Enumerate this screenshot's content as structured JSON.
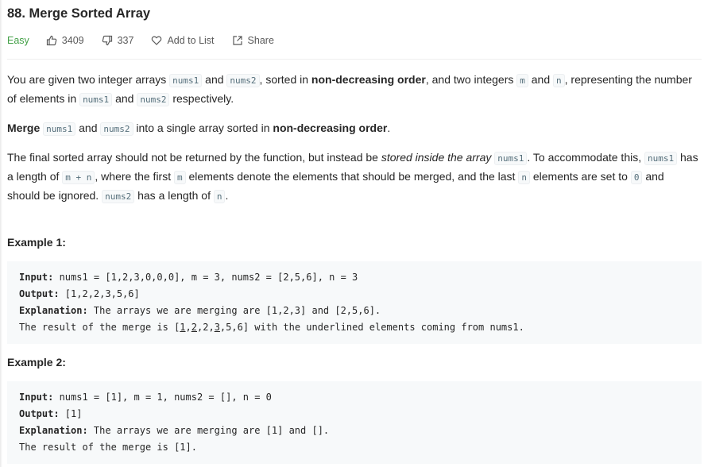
{
  "problem": {
    "title": "88. Merge Sorted Array",
    "difficulty": "Easy",
    "likes": "3409",
    "dislikes": "337",
    "add_to_list": "Add to List",
    "share": "Share"
  },
  "description": {
    "p1": {
      "t1": "You are given two integer arrays ",
      "c1": "nums1",
      "t2": " and ",
      "c2": "nums2",
      "t3": ", sorted in ",
      "b1": "non-decreasing order",
      "t4": ", and two integers ",
      "c3": "m",
      "t5": " and ",
      "c4": "n",
      "t6": ", representing the number of elements in ",
      "c5": "nums1",
      "t7": " and ",
      "c6": "nums2",
      "t8": " respectively."
    },
    "p2": {
      "b1": "Merge",
      "t1": " ",
      "c1": "nums1",
      "t2": " and ",
      "c2": "nums2",
      "t3": " into a single array sorted in ",
      "b2": "non-decreasing order",
      "t4": "."
    },
    "p3": {
      "t1": "The final sorted array should not be returned by the function, but instead be ",
      "i1": "stored inside the array",
      "t2": " ",
      "c1": "nums1",
      "t3": ". To accommodate this, ",
      "c2": "nums1",
      "t4": " has a length of ",
      "c3": "m + n",
      "t5": ", where the first ",
      "c4": "m",
      "t6": " elements denote the elements that should be merged, and the last ",
      "c5": "n",
      "t7": " elements are set to ",
      "c6": "0",
      "t8": " and should be ignored. ",
      "c7": "nums2",
      "t9": " has a length of ",
      "c8": "n",
      "t10": "."
    }
  },
  "examples": [
    {
      "title": "Example 1:",
      "input_label": "Input:",
      "input": " nums1 = [1,2,3,0,0,0], m = 3, nums2 = [2,5,6], n = 3",
      "output_label": "Output:",
      "output": " [1,2,2,3,5,6]",
      "explanation_label": "Explanation:",
      "explanation": " The arrays we are merging are [1,2,3] and [2,5,6].",
      "result_prefix": "The result of the merge is [",
      "r1": "1",
      "sep1": ",",
      "r2": "2",
      "sep2": ",2,",
      "r3": "3",
      "result_suffix": ",5,6] with the underlined elements coming from nums1."
    },
    {
      "title": "Example 2:",
      "input_label": "Input:",
      "input": " nums1 = [1], m = 1, nums2 = [], n = 0",
      "output_label": "Output:",
      "output": " [1]",
      "explanation_label": "Explanation:",
      "explanation": " The arrays we are merging are [1] and [].",
      "result": "The result of the merge is [1]."
    }
  ],
  "colors": {
    "easy": "#43a047",
    "code_text": "#546e7a",
    "code_bg": "#f7f9fa"
  },
  "icons": [
    "thumbs-up-icon",
    "thumbs-down-icon",
    "heart-icon",
    "share-icon"
  ]
}
